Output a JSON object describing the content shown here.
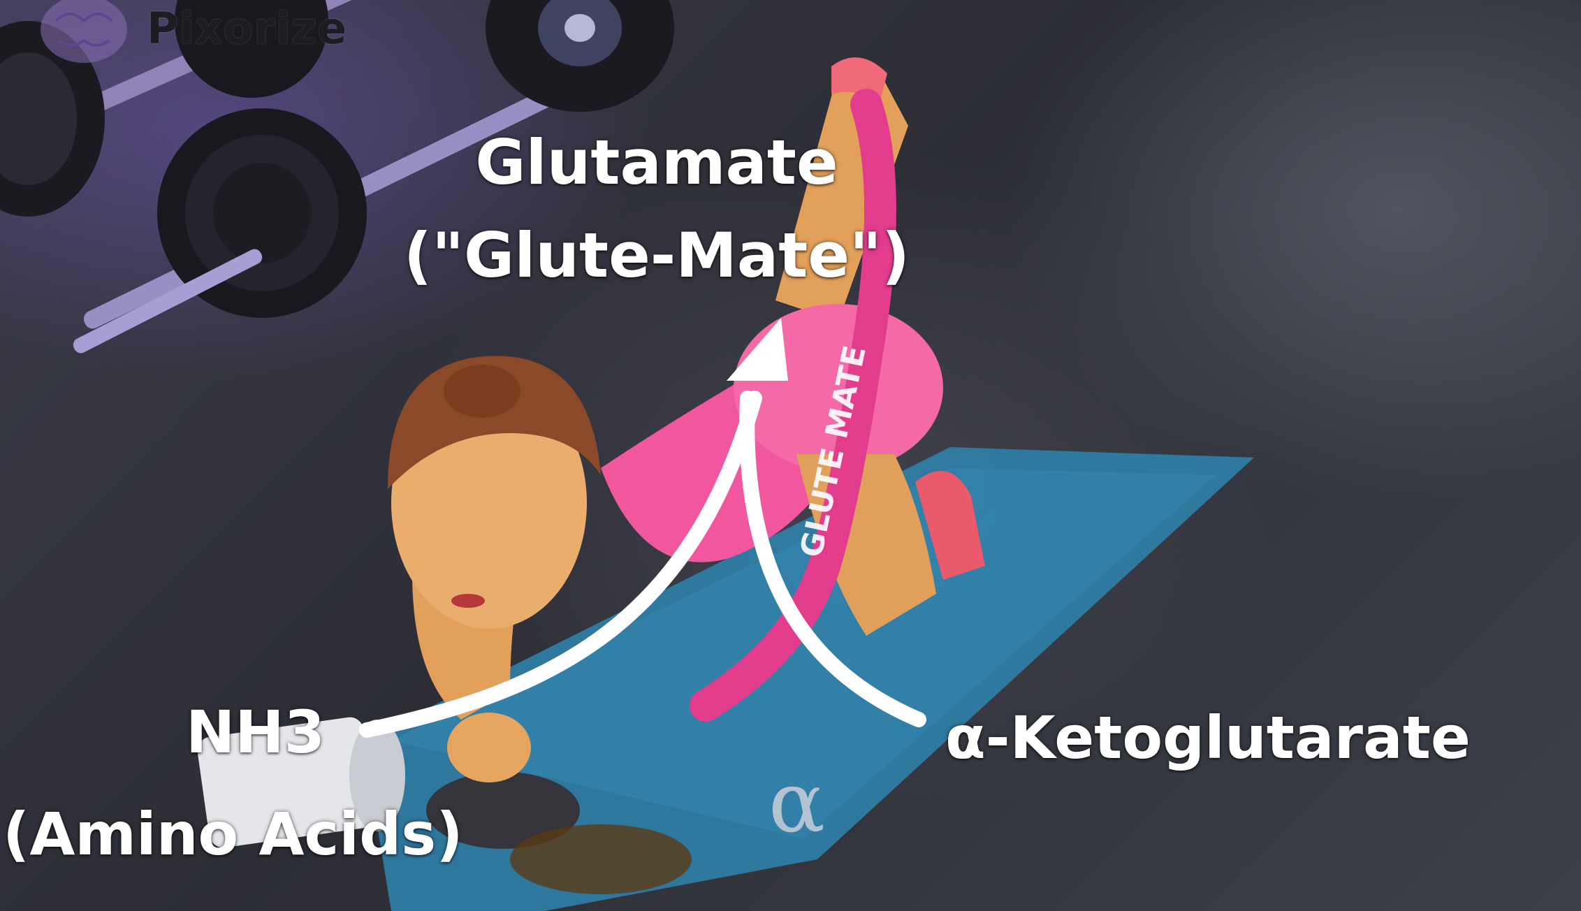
{
  "brand": {
    "name": "Pixorize"
  },
  "labels": {
    "product_name": "Glutamate",
    "product_mnemonic": "(\"Glute-Mate\")",
    "reactant_1": "NH3",
    "reactant_1_source": "(Amino Acids)",
    "reactant_2": "α-Ketoglutarate"
  },
  "illustration_text": {
    "band_label": "GLUTE MATE",
    "mat_symbol": "α"
  },
  "colors": {
    "label_text": "#ffffff",
    "outfit_pink": "#f0579f",
    "mat_blue": "#2f7fa8",
    "background": "#2e2f36"
  }
}
